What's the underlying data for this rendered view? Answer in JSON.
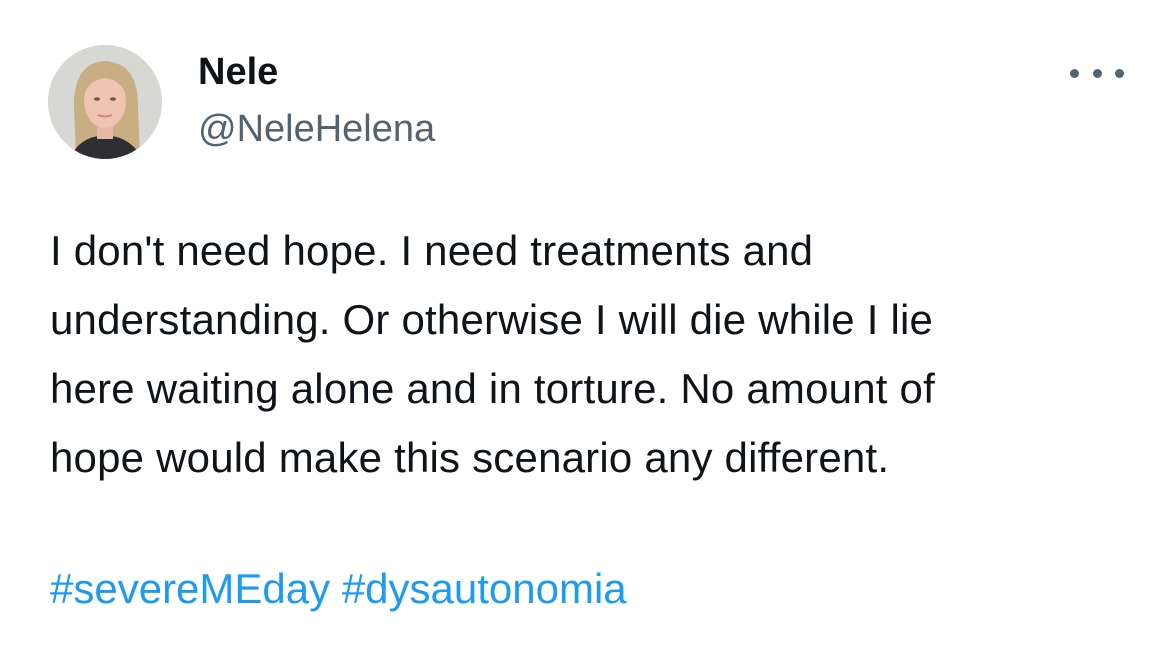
{
  "author": {
    "display_name": "Nele",
    "handle": "@NeleHelena",
    "avatar_icon": "user-avatar-photo"
  },
  "more_icon": "more-horizontal-icon",
  "tweet": {
    "text": "I don't need hope. I need treatments and\nunderstanding. Or otherwise I will die while I lie\nhere waiting alone and in torture. No amount of\nhope would make this scenario any different.",
    "hashtags": [
      "#severeMEday",
      "#dysautonomia"
    ]
  },
  "colors": {
    "text": "#0f1419",
    "secondary": "#536471",
    "link": "#1d9bf0"
  }
}
